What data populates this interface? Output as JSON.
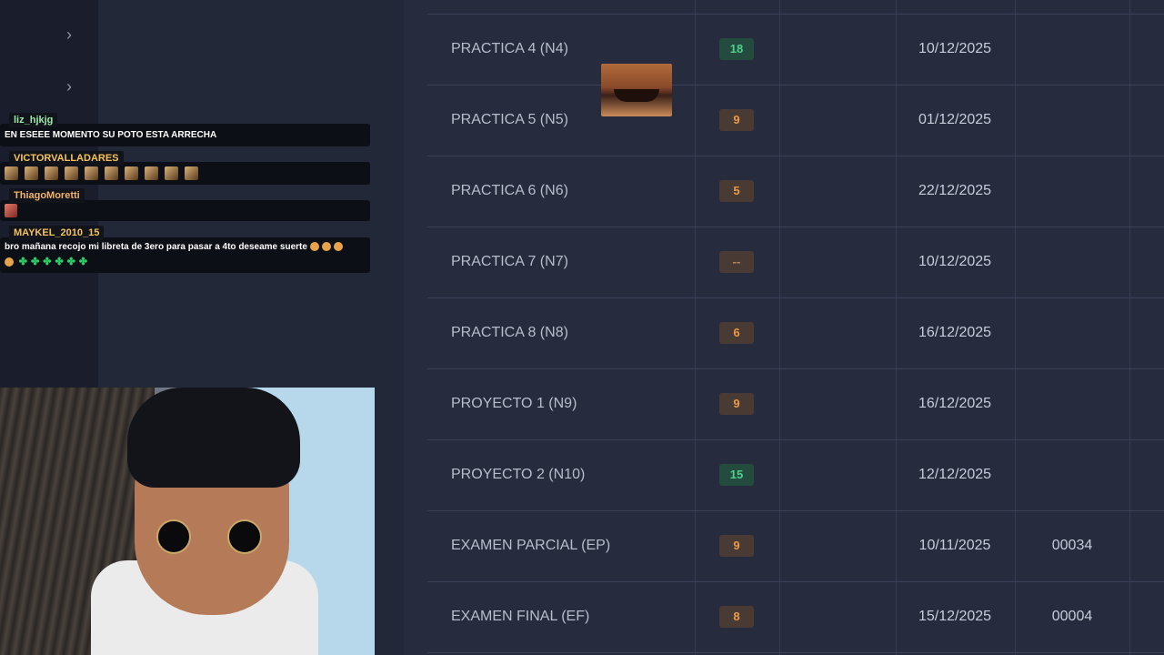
{
  "sidebar": {
    "chevrons": [
      "chevron-right-icon",
      "chevron-right-icon"
    ]
  },
  "chat": {
    "messages": [
      {
        "user": "liz_hjkjg",
        "user_color": "#9ee6a8",
        "text": "EN ESEEE MOMENTO SU POTO ESTA ARRECHA"
      },
      {
        "user": "VICTORVALLADARES",
        "user_color": "#f4c35a",
        "emotes": 10
      },
      {
        "user": "ThiagoMoretti",
        "user_color": "#f0b46a",
        "emotes": 1
      },
      {
        "user": "MAYKEL_2010_15",
        "user_color": "#f4c35a",
        "text": "bro mañana recojo mi libreta de 3ero para pasar a 4to deseame suerte"
      }
    ]
  },
  "grades": {
    "rows": [
      {
        "name": "PRACTICA 4 (N4)",
        "score": "18",
        "score_color": "green",
        "date": "10/12/2025",
        "code": ""
      },
      {
        "name": "PRACTICA 5 (N5)",
        "score": "9",
        "score_color": "orange",
        "date": "01/12/2025",
        "code": ""
      },
      {
        "name": "PRACTICA 6 (N6)",
        "score": "5",
        "score_color": "orange",
        "date": "22/12/2025",
        "code": ""
      },
      {
        "name": "PRACTICA 7 (N7)",
        "score": "--",
        "score_color": "dash",
        "date": "10/12/2025",
        "code": ""
      },
      {
        "name": "PRACTICA 8 (N8)",
        "score": "6",
        "score_color": "orange",
        "date": "16/12/2025",
        "code": ""
      },
      {
        "name": "PROYECTO 1 (N9)",
        "score": "9",
        "score_color": "orange",
        "date": "16/12/2025",
        "code": ""
      },
      {
        "name": "PROYECTO 2 (N10)",
        "score": "15",
        "score_color": "green",
        "date": "12/12/2025",
        "code": ""
      },
      {
        "name": "EXAMEN PARCIAL (EP)",
        "score": "9",
        "score_color": "orange",
        "date": "10/11/2025",
        "code": "00034"
      },
      {
        "name": "EXAMEN FINAL (EF)",
        "score": "8",
        "score_color": "orange",
        "date": "15/12/2025",
        "code": "00004"
      }
    ]
  },
  "colors": {
    "score_green": "#4fd18e",
    "score_orange": "#e89a4c",
    "background": "#262b3d"
  }
}
